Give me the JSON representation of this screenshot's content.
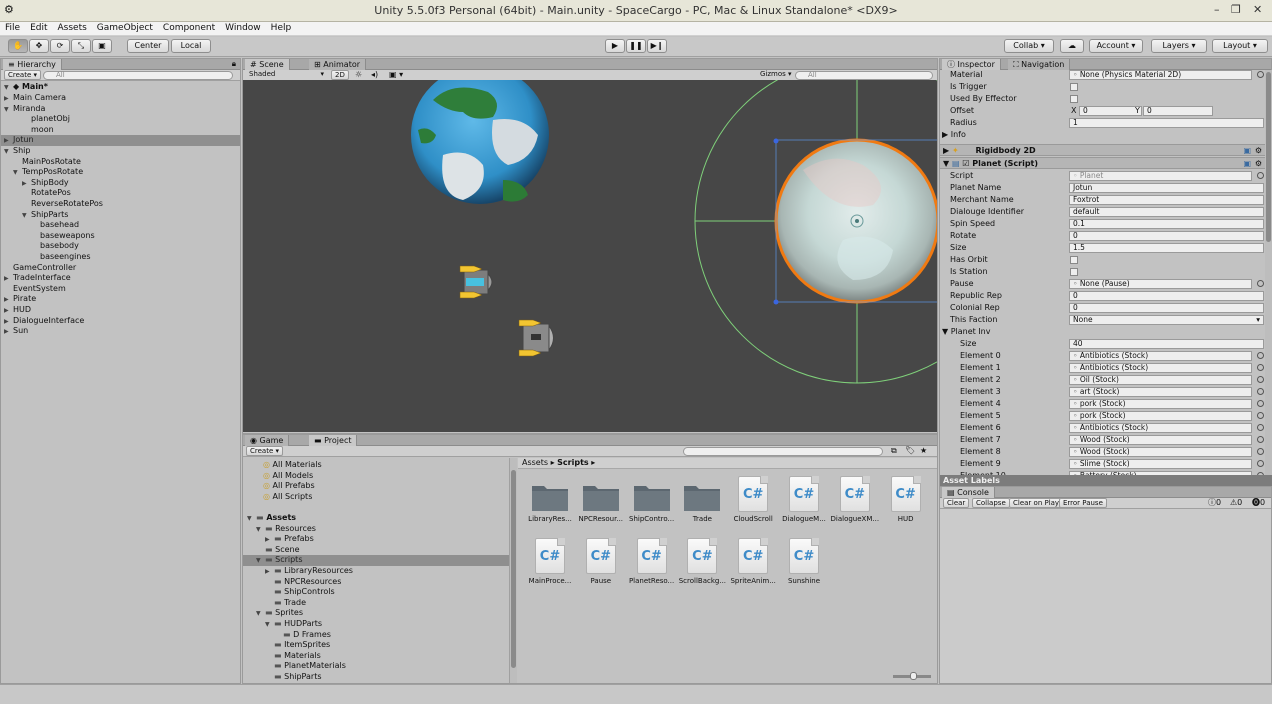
{
  "window": {
    "title": "Unity 5.5.0f3 Personal (64bit) - Main.unity - SpaceCargo - PC, Mac & Linux Standalone* <DX9>"
  },
  "menu": [
    "File",
    "Edit",
    "Assets",
    "GameObject",
    "Component",
    "Window",
    "Help"
  ],
  "toolbar": {
    "pivot": "Center",
    "space": "Local",
    "collab": "Collab",
    "account": "Account",
    "layers": "Layers",
    "layout": "Layout"
  },
  "hierarchy": {
    "tab": "Hierarchy",
    "create": "Create",
    "search_placeholder": "All",
    "scene": "Main*",
    "items": [
      {
        "label": "Main Camera",
        "indent": 1,
        "arrow": "right",
        "selected": false
      },
      {
        "label": "Miranda",
        "indent": 1,
        "arrow": "down",
        "selected": false
      },
      {
        "label": "planetObj",
        "indent": 3,
        "arrow": "",
        "selected": false
      },
      {
        "label": "moon",
        "indent": 3,
        "arrow": "",
        "selected": false
      },
      {
        "label": "Jotun",
        "indent": 1,
        "arrow": "right",
        "selected": true
      },
      {
        "label": "Ship",
        "indent": 1,
        "arrow": "down",
        "selected": false
      },
      {
        "label": "MainPosRotate",
        "indent": 2,
        "arrow": "",
        "selected": false
      },
      {
        "label": "TempPosRotate",
        "indent": 2,
        "arrow": "down",
        "selected": false
      },
      {
        "label": "ShipBody",
        "indent": 3,
        "arrow": "right",
        "selected": false
      },
      {
        "label": "RotatePos",
        "indent": 3,
        "arrow": "",
        "selected": false
      },
      {
        "label": "ReverseRotatePos",
        "indent": 3,
        "arrow": "",
        "selected": false
      },
      {
        "label": "ShipParts",
        "indent": 3,
        "arrow": "down",
        "selected": false
      },
      {
        "label": "basehead",
        "indent": 4,
        "arrow": "",
        "selected": false
      },
      {
        "label": "baseweapons",
        "indent": 4,
        "arrow": "",
        "selected": false
      },
      {
        "label": "basebody",
        "indent": 4,
        "arrow": "",
        "selected": false
      },
      {
        "label": "baseengines",
        "indent": 4,
        "arrow": "",
        "selected": false
      },
      {
        "label": "GameController",
        "indent": 1,
        "arrow": "",
        "selected": false
      },
      {
        "label": "TradeInterface",
        "indent": 1,
        "arrow": "right",
        "selected": false
      },
      {
        "label": "EventSystem",
        "indent": 1,
        "arrow": "",
        "selected": false
      },
      {
        "label": "Pirate",
        "indent": 1,
        "arrow": "right",
        "selected": false
      },
      {
        "label": "HUD",
        "indent": 1,
        "arrow": "right",
        "selected": false
      },
      {
        "label": "DialogueInterface",
        "indent": 1,
        "arrow": "right",
        "selected": false
      },
      {
        "label": "Sun",
        "indent": 1,
        "arrow": "right",
        "selected": false
      }
    ]
  },
  "scene": {
    "tab_scene": "Scene",
    "tab_animator": "Animator",
    "shading": "Shaded",
    "mode_2d": "2D",
    "gizmos": "Gizmos",
    "search_placeholder": "All"
  },
  "project": {
    "tab_game": "Game",
    "tab_project": "Project",
    "create": "Create",
    "favorites": [
      "All Materials",
      "All Models",
      "All Prefabs",
      "All Scripts"
    ],
    "tree": [
      {
        "label": "Assets",
        "indent": 0,
        "arrow": "down",
        "bold": true,
        "selected": false
      },
      {
        "label": "Resources",
        "indent": 1,
        "arrow": "down",
        "bold": false,
        "selected": false
      },
      {
        "label": "Prefabs",
        "indent": 2,
        "arrow": "right",
        "bold": false,
        "selected": false
      },
      {
        "label": "Scene",
        "indent": 1,
        "arrow": "",
        "bold": false,
        "selected": false
      },
      {
        "label": "Scripts",
        "indent": 1,
        "arrow": "down",
        "bold": false,
        "selected": true
      },
      {
        "label": "LibraryResources",
        "indent": 2,
        "arrow": "right",
        "bold": false,
        "selected": false
      },
      {
        "label": "NPCResources",
        "indent": 2,
        "arrow": "",
        "bold": false,
        "selected": false
      },
      {
        "label": "ShipControls",
        "indent": 2,
        "arrow": "",
        "bold": false,
        "selected": false
      },
      {
        "label": "Trade",
        "indent": 2,
        "arrow": "",
        "bold": false,
        "selected": false
      },
      {
        "label": "Sprites",
        "indent": 1,
        "arrow": "down",
        "bold": false,
        "selected": false
      },
      {
        "label": "HUDParts",
        "indent": 2,
        "arrow": "down",
        "bold": false,
        "selected": false
      },
      {
        "label": "D Frames",
        "indent": 3,
        "arrow": "",
        "bold": false,
        "selected": false
      },
      {
        "label": "ItemSprites",
        "indent": 2,
        "arrow": "",
        "bold": false,
        "selected": false
      },
      {
        "label": "Materials",
        "indent": 2,
        "arrow": "",
        "bold": false,
        "selected": false
      },
      {
        "label": "PlanetMaterials",
        "indent": 2,
        "arrow": "",
        "bold": false,
        "selected": false
      },
      {
        "label": "ShipParts",
        "indent": 2,
        "arrow": "",
        "bold": false,
        "selected": false
      }
    ],
    "breadcrumb": [
      "Assets",
      "Scripts"
    ],
    "files": [
      {
        "label": "LibraryRes...",
        "type": "folder"
      },
      {
        "label": "NPCResour...",
        "type": "folder"
      },
      {
        "label": "ShipContro...",
        "type": "folder"
      },
      {
        "label": "Trade",
        "type": "folder"
      },
      {
        "label": "CloudScroll",
        "type": "cs"
      },
      {
        "label": "DialogueM...",
        "type": "cs"
      },
      {
        "label": "DialogueXM...",
        "type": "cs"
      },
      {
        "label": "HUD",
        "type": "cs"
      },
      {
        "label": "MainProce...",
        "type": "cs"
      },
      {
        "label": "Pause",
        "type": "cs"
      },
      {
        "label": "PlanetReso...",
        "type": "cs"
      },
      {
        "label": "ScrollBackg...",
        "type": "cs"
      },
      {
        "label": "SpriteAnim...",
        "type": "cs"
      },
      {
        "label": "Sunshine",
        "type": "cs"
      }
    ]
  },
  "inspector": {
    "tab_inspector": "Inspector",
    "tab_navigation": "Navigation",
    "collider": [
      {
        "label": "Material",
        "value": "None (Physics Material 2D)",
        "kind": "object"
      },
      {
        "label": "Is Trigger",
        "value": "",
        "kind": "check"
      },
      {
        "label": "Used By Effector",
        "value": "",
        "kind": "check"
      }
    ],
    "offset_label": "Offset",
    "offset_x_label": "X",
    "offset_x": "0",
    "offset_y_label": "Y",
    "offset_y": "0",
    "radius_label": "Radius",
    "radius": "1",
    "info_label": "Info",
    "rigidbody": "Rigidbody 2D",
    "planet_script": "Planet (Script)",
    "fields": [
      {
        "label": "Script",
        "value": "Planet",
        "kind": "script"
      },
      {
        "label": "Planet Name",
        "value": "Jotun",
        "kind": "text"
      },
      {
        "label": "Merchant Name",
        "value": "Foxtrot",
        "kind": "text"
      },
      {
        "label": "Dialouge Identifier",
        "value": "default",
        "kind": "text"
      },
      {
        "label": "Spin Speed",
        "value": "0.1",
        "kind": "text"
      },
      {
        "label": "Rotate",
        "value": "0",
        "kind": "text"
      },
      {
        "label": "Size",
        "value": "1.5",
        "kind": "text"
      },
      {
        "label": "Has Orbit",
        "value": "",
        "kind": "check"
      },
      {
        "label": "Is Station",
        "value": "",
        "kind": "check"
      },
      {
        "label": "Pause",
        "value": "None (Pause)",
        "kind": "object"
      },
      {
        "label": "Republic Rep",
        "value": "0",
        "kind": "text"
      },
      {
        "label": "Colonial Rep",
        "value": "0",
        "kind": "text"
      },
      {
        "label": "This Faction",
        "value": "None",
        "kind": "enum"
      }
    ],
    "planet_inv_label": "Planet Inv",
    "inv_size_label": "Size",
    "inv_size": "40",
    "elements": [
      {
        "label": "Element 0",
        "value": "Antibiotics (Stock)"
      },
      {
        "label": "Element 1",
        "value": "Antibiotics (Stock)"
      },
      {
        "label": "Element 2",
        "value": "Oil (Stock)"
      },
      {
        "label": "Element 3",
        "value": "art (Stock)"
      },
      {
        "label": "Element 4",
        "value": "pork (Stock)"
      },
      {
        "label": "Element 5",
        "value": "pork (Stock)"
      },
      {
        "label": "Element 6",
        "value": "Antibiotics (Stock)"
      },
      {
        "label": "Element 7",
        "value": "Wood (Stock)"
      },
      {
        "label": "Element 8",
        "value": "Wood (Stock)"
      },
      {
        "label": "Element 9",
        "value": "Slime (Stock)"
      },
      {
        "label": "Element 10",
        "value": "Battery (Stock)"
      }
    ],
    "asset_labels": "Asset Labels"
  },
  "console": {
    "tab": "Console",
    "buttons": [
      "Clear",
      "Collapse",
      "Clear on Play",
      "Error Pause"
    ],
    "counts": [
      "0",
      "0",
      "0"
    ]
  }
}
